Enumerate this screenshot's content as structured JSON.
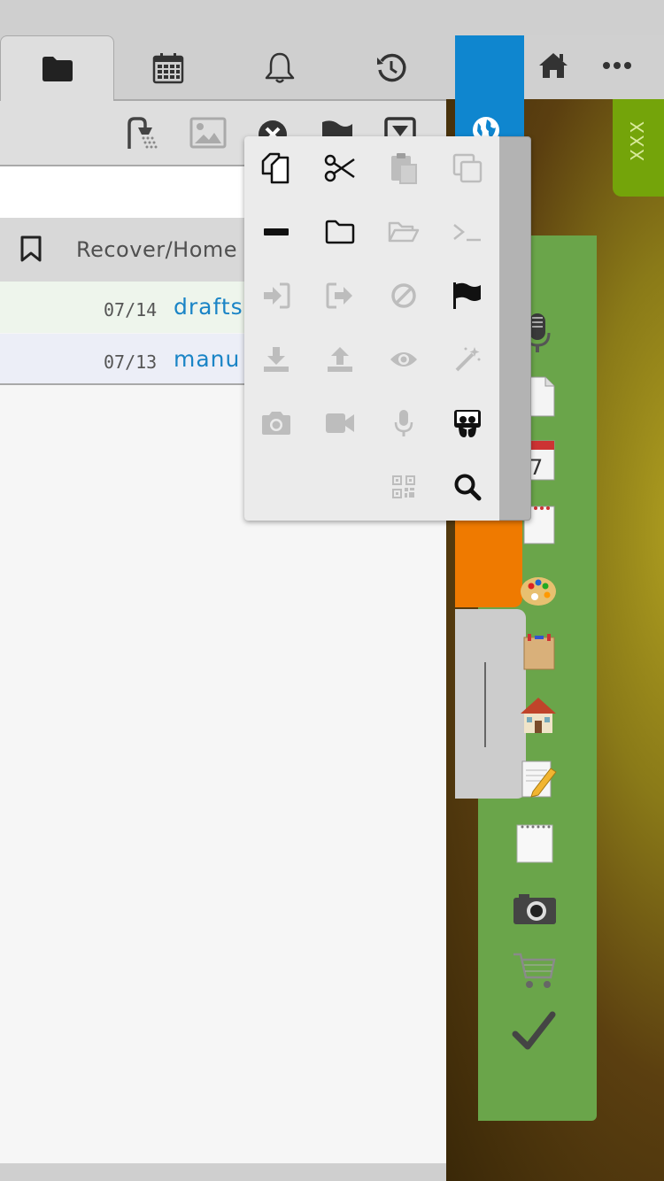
{
  "tabs": [
    {
      "id": "files",
      "icon": "folder-icon",
      "active": true
    },
    {
      "id": "calendar",
      "icon": "calendar-icon",
      "active": false
    },
    {
      "id": "notifications",
      "icon": "bell-icon",
      "active": false
    },
    {
      "id": "history",
      "icon": "history-icon",
      "active": false
    }
  ],
  "toolbar": [
    "shower-icon",
    "image-icon",
    "close-circle-icon",
    "flag-icon",
    "dropdown-box-icon"
  ],
  "header": {
    "bookmark_icon": "bookmark-icon",
    "path": "Recover/Home"
  },
  "files": [
    {
      "date": "07/14",
      "name": "drafts"
    },
    {
      "date": "07/13",
      "name": "manu"
    }
  ],
  "top_right": {
    "home_icon": "home-icon",
    "more_icon": "more-dots-icon"
  },
  "green_tab": {
    "label": "XXX"
  },
  "popup_menu": {
    "rows": [
      [
        "copy-icon",
        "cut-scissors-icon",
        "paste-icon",
        "duplicate-icon"
      ],
      [
        "minus-icon",
        "folder-outline-icon",
        "folder-open-icon",
        "terminal-icon"
      ],
      [
        "sign-in-icon",
        "sign-out-icon",
        "ban-icon",
        "flag-icon"
      ],
      [
        "download-icon",
        "upload-icon",
        "eye-icon",
        "magic-wand-icon"
      ],
      [
        "camera-icon",
        "video-icon",
        "microphone-icon",
        "slideshare-icon"
      ],
      [
        "",
        "",
        "qr-code-icon",
        "search-icon"
      ]
    ]
  },
  "desktop_icons": [
    "microphone-app-icon",
    "document-app-icon",
    "calendar-app-icon",
    "notepad-app-icon",
    "palette-app-icon",
    "calendar-box-app-icon",
    "house-app-icon",
    "note-pencil-app-icon",
    "notepad-blank-app-icon",
    "camera-app-icon",
    "shopping-cart-app-icon",
    "checkmark-app-icon"
  ],
  "colors": {
    "accent_blue": "#0f86cf",
    "accent_orange": "#ef7a00",
    "green_panel": "#6aa54a",
    "link_blue": "#1a84c6"
  }
}
